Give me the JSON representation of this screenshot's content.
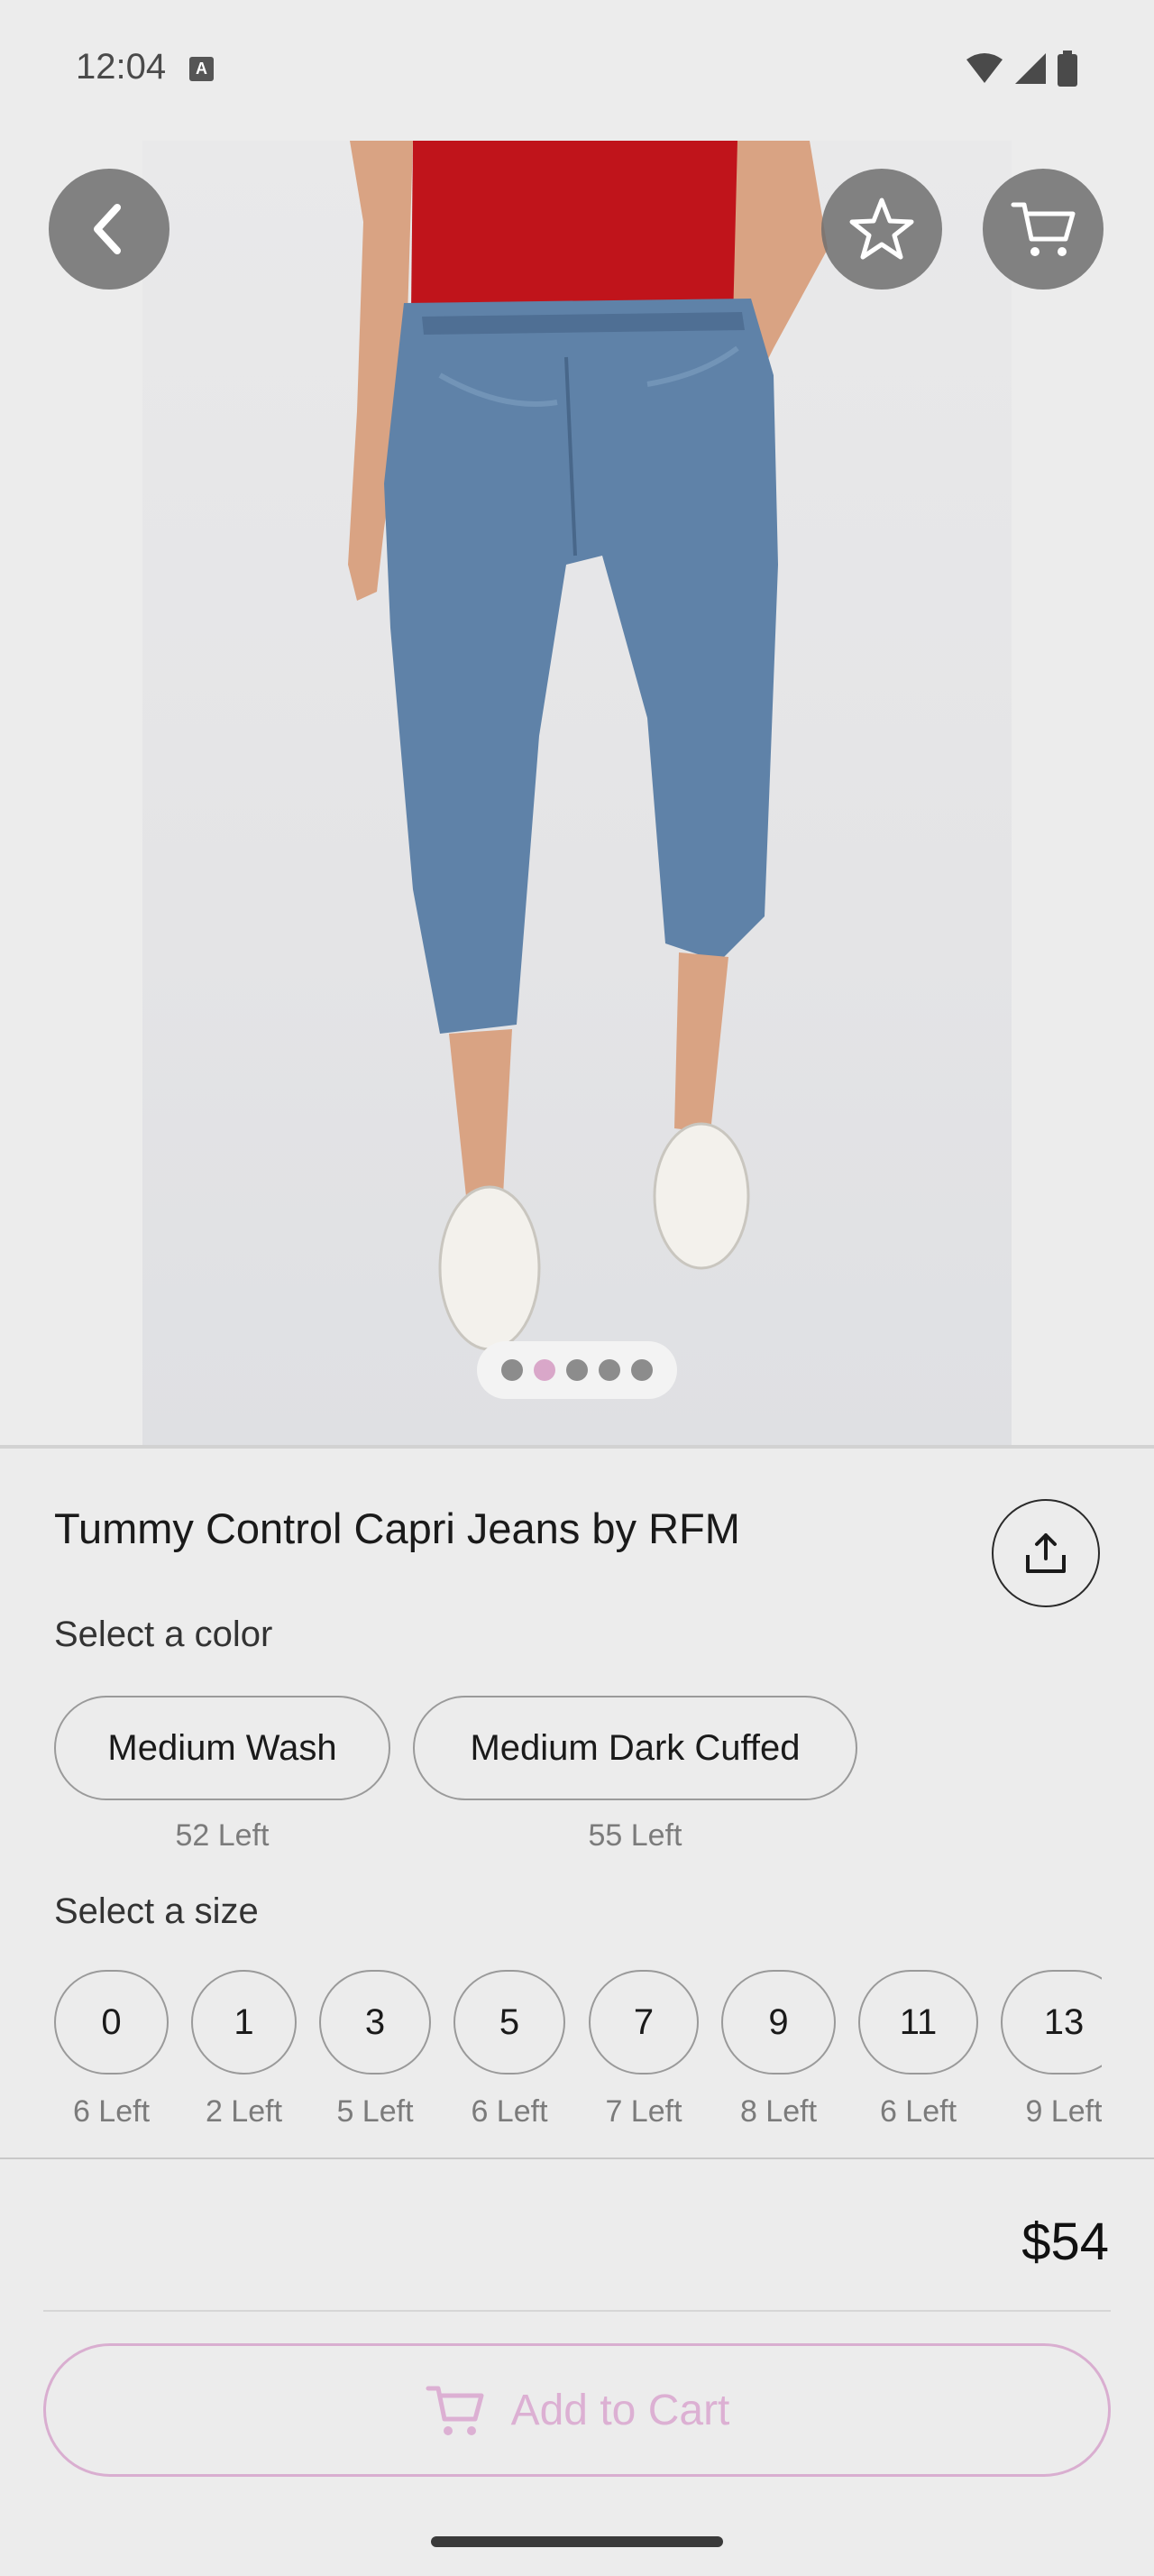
{
  "status_bar": {
    "time": "12:04",
    "a_icon": "A",
    "icons": [
      "wifi-icon",
      "signal-icon",
      "battery-icon"
    ]
  },
  "gallery": {
    "image_count": 5,
    "active_index": 1
  },
  "product": {
    "title": "Tummy Control Capri Jeans by RFM",
    "price": "$54"
  },
  "colors": {
    "label": "Select a color",
    "options": [
      {
        "name": "Medium Wash",
        "stock": "52 Left"
      },
      {
        "name": "Medium Dark Cuffed",
        "stock": "55 Left"
      }
    ]
  },
  "sizes": {
    "label": "Select a size",
    "options": [
      {
        "name": "0",
        "stock": "6 Left"
      },
      {
        "name": "1",
        "stock": "2 Left"
      },
      {
        "name": "3",
        "stock": "5 Left"
      },
      {
        "name": "5",
        "stock": "6 Left"
      },
      {
        "name": "7",
        "stock": "7 Left"
      },
      {
        "name": "9",
        "stock": "8 Left"
      },
      {
        "name": "11",
        "stock": "6 Left"
      },
      {
        "name": "13",
        "stock": "9 Left"
      }
    ]
  },
  "actions": {
    "add_to_cart": "Add to Cart"
  },
  "colors_theme": {
    "accent_pink": "#d9aed0",
    "dot_active": "#d9a7c9",
    "overlay_button": "#6e6e6e",
    "background": "#ececec"
  }
}
